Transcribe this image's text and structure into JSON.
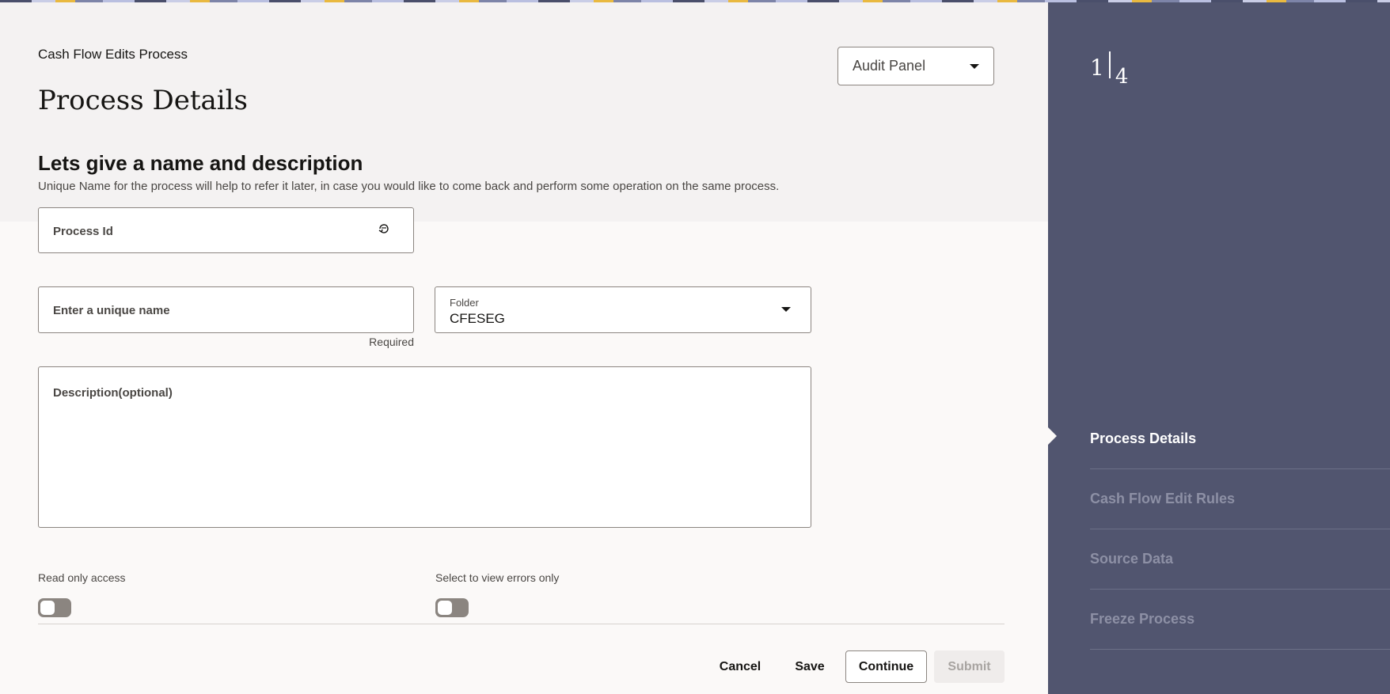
{
  "header": {
    "breadcrumb": "Cash Flow Edits Process",
    "title": "Process Details",
    "audit_panel": "Audit Panel"
  },
  "section": {
    "title": "Lets give a name and description",
    "subtitle": "Unique Name for the process will help to refer it later, in case you would like to come back and perform some operation on the same process."
  },
  "form": {
    "process_id_placeholder": "Process Id",
    "name_placeholder": "Enter a unique name",
    "name_required": "Required",
    "folder_label": "Folder",
    "folder_value": "CFESEG",
    "description_placeholder": "Description(optional)",
    "read_only_label": "Read only access",
    "read_only_on": false,
    "errors_only_label": "Select to view errors only",
    "errors_only_on": false
  },
  "actions": {
    "cancel": "Cancel",
    "save": "Save",
    "continue": "Continue",
    "submit": "Submit"
  },
  "train": {
    "current": "1",
    "total": "4",
    "steps": [
      {
        "label": "Process Details",
        "active": true
      },
      {
        "label": "Cash Flow Edit Rules",
        "active": false
      },
      {
        "label": "Source Data",
        "active": false
      },
      {
        "label": "Freeze Process",
        "active": false
      }
    ]
  },
  "colors": {
    "rail_bg": "#51556f",
    "accent": "#161513",
    "toggle_off": "#8b8580"
  },
  "icons": {
    "refresh": "refresh-icon",
    "dropdown": "chevron-down-icon"
  }
}
